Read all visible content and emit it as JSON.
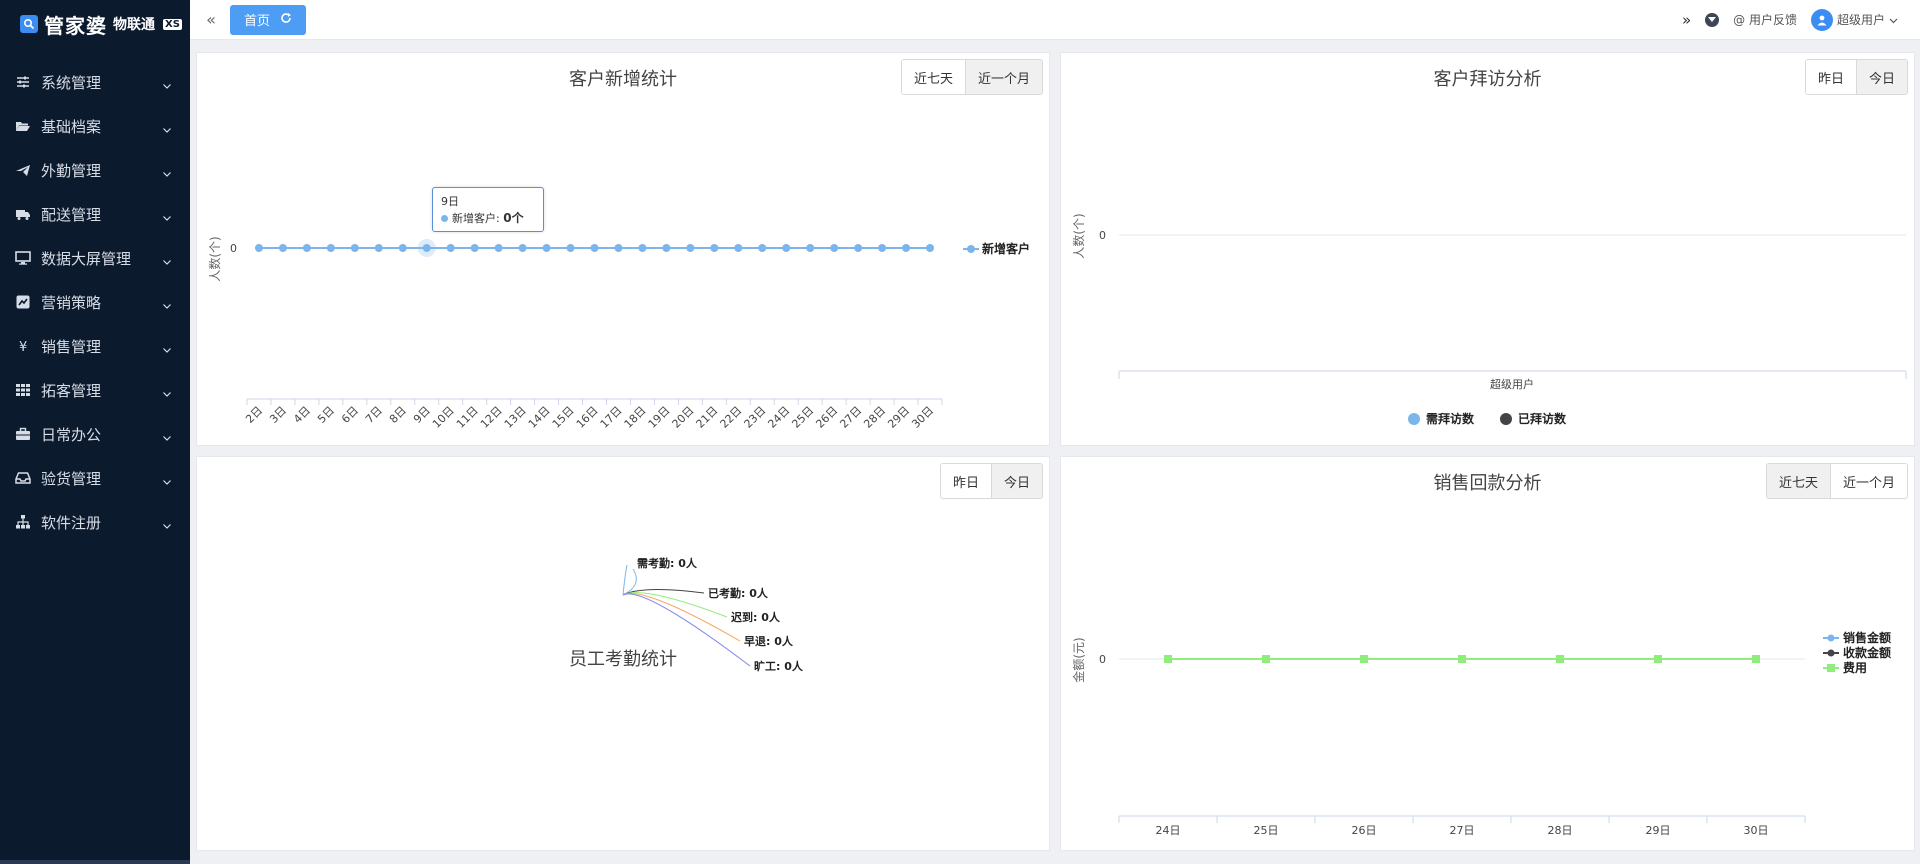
{
  "app": {
    "logo_text": "管家婆",
    "logo_sub": "物联通",
    "logo_badge": "XS"
  },
  "sidebar": {
    "items": [
      {
        "label": "系统管理",
        "icon": "sliders-icon"
      },
      {
        "label": "基础档案",
        "icon": "folder-open-icon"
      },
      {
        "label": "外勤管理",
        "icon": "plane-icon"
      },
      {
        "label": "配送管理",
        "icon": "truck-icon"
      },
      {
        "label": "数据大屏管理",
        "icon": "monitor-icon"
      },
      {
        "label": "营销策略",
        "icon": "chart-square-icon"
      },
      {
        "label": "销售管理",
        "icon": "yen-icon"
      },
      {
        "label": "拓客管理",
        "icon": "grid-icon"
      },
      {
        "label": "日常办公",
        "icon": "briefcase-icon"
      },
      {
        "label": "验货管理",
        "icon": "inbox-icon"
      },
      {
        "label": "软件注册",
        "icon": "sitemap-icon"
      }
    ]
  },
  "topbar": {
    "collapse": "«",
    "home_tab": "首页",
    "feedback": "@ 用户反馈",
    "user": "超级用户",
    "more": "»"
  },
  "cards": {
    "new_customers": {
      "title": "客户新增统计",
      "buttons": [
        "近七天",
        "近一个月"
      ],
      "active": 1
    },
    "visits": {
      "title": "客户拜访分析",
      "buttons": [
        "昨日",
        "今日"
      ],
      "active": 1
    },
    "attendance": {
      "title": "员工考勤统计",
      "buttons": [
        "昨日",
        "今日"
      ],
      "active": 1
    },
    "sales": {
      "title": "销售回款分析",
      "buttons": [
        "近七天",
        "近一个月"
      ],
      "active": 0
    }
  },
  "tooltip": {
    "date": "9日",
    "label": "新增客户:",
    "value": "0个"
  },
  "colors": {
    "sidebar_bg": "#0c1a2e",
    "accent": "#4d9df5",
    "series_blue": "#7cb5ec",
    "series_dark": "#434348",
    "series_green": "#90ed7d",
    "series_orange": "#f7a35c",
    "series_purple": "#8085e9"
  },
  "chart_data": [
    {
      "type": "line",
      "title": "客户新增统计",
      "ylabel": "人数(个)",
      "x": [
        "2日",
        "3日",
        "4日",
        "5日",
        "6日",
        "7日",
        "8日",
        "9日",
        "10日",
        "11日",
        "12日",
        "13日",
        "14日",
        "15日",
        "16日",
        "17日",
        "18日",
        "19日",
        "20日",
        "21日",
        "22日",
        "23日",
        "24日",
        "25日",
        "26日",
        "27日",
        "28日",
        "29日",
        "30日"
      ],
      "series": [
        {
          "name": "新增客户",
          "values": [
            0,
            0,
            0,
            0,
            0,
            0,
            0,
            0,
            0,
            0,
            0,
            0,
            0,
            0,
            0,
            0,
            0,
            0,
            0,
            0,
            0,
            0,
            0,
            0,
            0,
            0,
            0,
            0,
            0
          ]
        }
      ],
      "yticks": [
        "0"
      ],
      "legend": "right"
    },
    {
      "type": "bar",
      "title": "客户拜访分析",
      "ylabel": "人数(个)",
      "categories": [
        "超级用户"
      ],
      "series": [
        {
          "name": "需拜访数",
          "values": [
            0
          ]
        },
        {
          "name": "已拜访数",
          "values": [
            0
          ]
        }
      ],
      "yticks": [
        "0"
      ],
      "legend": "bottom"
    },
    {
      "type": "pie",
      "title": "员工考勤统计",
      "slices": [
        {
          "name": "需考勤",
          "value": 0,
          "label": "0人"
        },
        {
          "name": "已考勤",
          "value": 0,
          "label": "0人"
        },
        {
          "name": "迟到",
          "value": 0,
          "label": "0人"
        },
        {
          "name": "早退",
          "value": 0,
          "label": "0人"
        },
        {
          "name": "旷工",
          "value": 0,
          "label": "0人"
        }
      ]
    },
    {
      "type": "line",
      "title": "销售回款分析",
      "ylabel": "金额(元)",
      "x": [
        "24日",
        "25日",
        "26日",
        "27日",
        "28日",
        "29日",
        "30日"
      ],
      "series": [
        {
          "name": "销售金额",
          "values": [
            0,
            0,
            0,
            0,
            0,
            0,
            0
          ]
        },
        {
          "name": "收款金额",
          "values": [
            0,
            0,
            0,
            0,
            0,
            0,
            0
          ]
        },
        {
          "name": "费用",
          "values": [
            0,
            0,
            0,
            0,
            0,
            0,
            0
          ]
        }
      ],
      "yticks": [
        "0"
      ],
      "legend": "right"
    }
  ]
}
